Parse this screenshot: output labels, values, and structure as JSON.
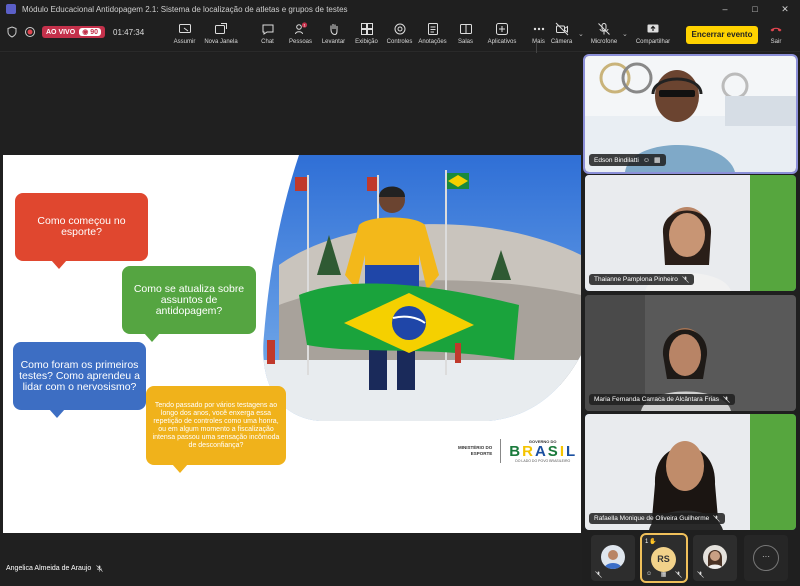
{
  "window": {
    "title": "Módulo Educacional Antidopagem 2.1: Sistema de localização de atletas e grupos de testes",
    "controls": [
      "–",
      "□",
      "✕"
    ]
  },
  "status": {
    "live_label": "AO VIVO",
    "viewers": "90",
    "timer": "01:47:34"
  },
  "toolbar": {
    "actions": [
      {
        "label": "Assumir",
        "icon": "take-control-icon"
      },
      {
        "label": "Nova Janela",
        "icon": "new-window-icon"
      },
      {
        "label": "Chat",
        "icon": "chat-icon"
      },
      {
        "label": "Pessoas",
        "icon": "people-icon",
        "badge": "1"
      },
      {
        "label": "Levantar",
        "icon": "raise-hand-icon"
      },
      {
        "label": "Exibição",
        "icon": "view-icon"
      },
      {
        "label": "Controles",
        "icon": "controls-icon"
      },
      {
        "label": "Anotações",
        "icon": "notes-icon"
      },
      {
        "label": "Salas",
        "icon": "rooms-icon"
      },
      {
        "label": "Aplicativos",
        "icon": "apps-icon"
      },
      {
        "label": "Mais",
        "icon": "more-icon"
      }
    ],
    "camera_label": "Câmera",
    "mic_label": "Microfone",
    "share_label": "Compartilhar",
    "end_label": "Encerrar evento",
    "leave_label": "Sair"
  },
  "slide": {
    "q1": "Como começou no esporte?",
    "q2": "Como se atualiza sobre assuntos de antidopagem?",
    "q3": "Como foram os primeiros testes? Como aprendeu a lidar com o nervosismo?",
    "q4": "Tendo passado por vários testagens ao longo dos anos, você enxerga essa repetição de controles como uma honra, ou em algum momento a fiscalização intensa passou uma sensação incômoda de desconfiança?",
    "ministry_line1": "MINISTÉRIO DO",
    "ministry_line2": "ESPORTE",
    "gov_top": "GOVERNO DO",
    "gov_word": [
      "B",
      "R",
      "A",
      "S",
      "I",
      "L"
    ],
    "gov_word_colors": [
      "#1a7a3c",
      "#f5c400",
      "#1a4fa0",
      "#1a7a3c",
      "#f5c400",
      "#1a4fa0"
    ],
    "gov_sub": "DO LADO DO POVO BRASILEIRO"
  },
  "presenter": {
    "name": "Angelica Almeida de Araujo"
  },
  "participants": [
    {
      "name": "Edson Bindilatti",
      "muted": false
    },
    {
      "name": "Thaianne Pamplona Pinheiro",
      "muted": true
    },
    {
      "name": "Maria Fernanda Carraca de Alcântara Frias",
      "muted": true
    },
    {
      "name": "Rafaella Monique de Oliveira Guilherme",
      "muted": true
    }
  ],
  "gallery": {
    "rs_initials": "RS",
    "rs_hand_count": "1",
    "more_label": "···"
  },
  "colors": {
    "accent": "#5b5fc7",
    "end_button": "#ffd200",
    "live": "#c4314b",
    "leave": "#e0454f"
  }
}
